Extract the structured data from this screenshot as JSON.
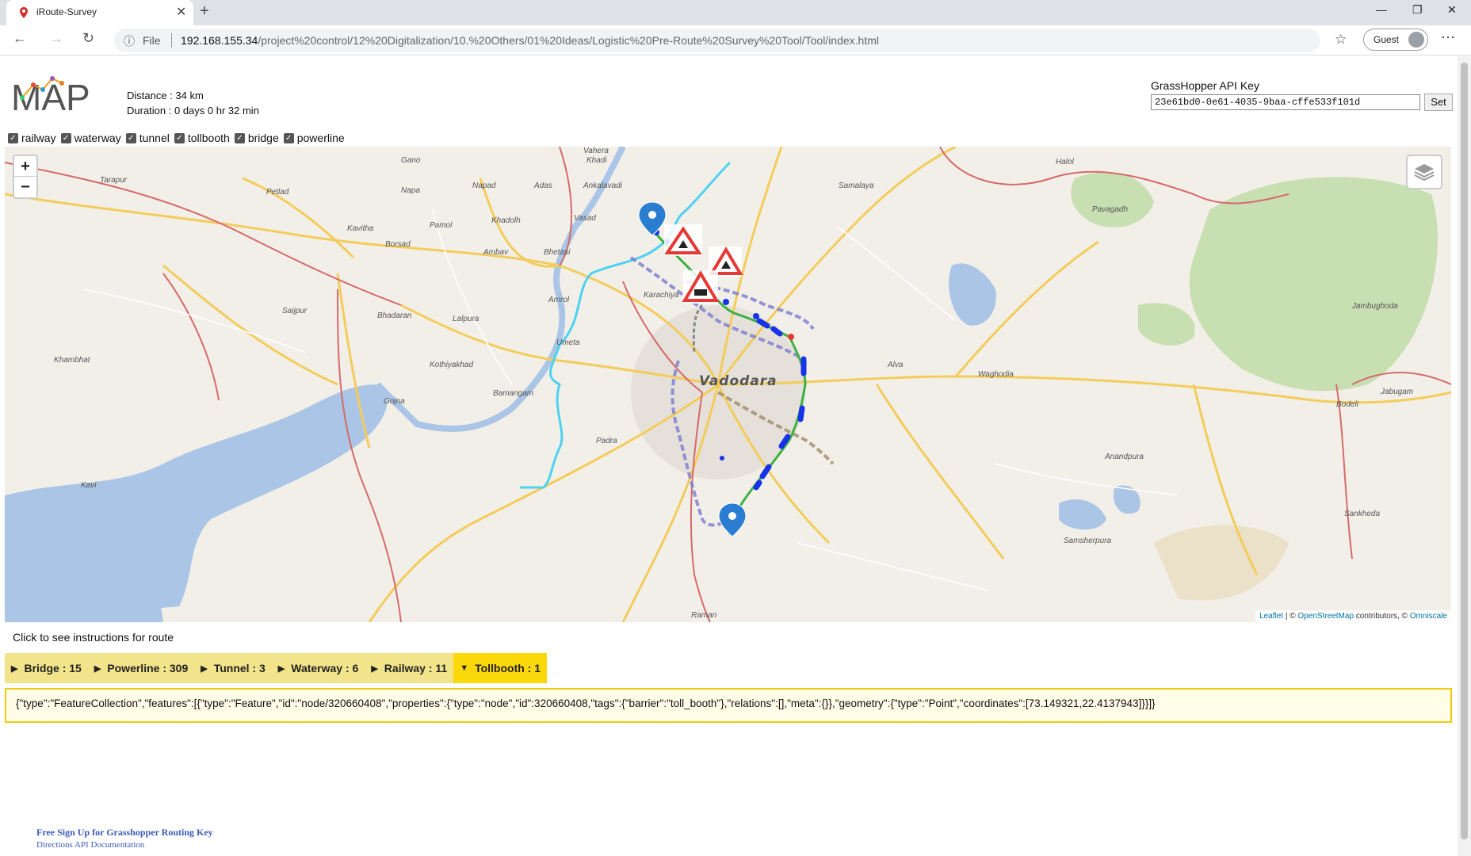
{
  "browser": {
    "tab_title": "iRoute-Survey",
    "close_glyph": "✕",
    "new_tab_glyph": "+",
    "omnibox": {
      "info_glyph": "ⓘ",
      "scheme_label": "File",
      "host": "192.168.155.34",
      "path": "/project%20control/12%20Digitalization/10.%20Others/01%20Ideas/Logistic%20Pre-Route%20Survey%20Tool/Tool/index.html"
    },
    "guest_label": "Guest",
    "star_icon": "star-icon",
    "menu_glyph": "⋯"
  },
  "header": {
    "logo_text": "MAP",
    "distance": "Distance : 34 km",
    "duration": "Duration : 0 days 0 hr 32 min",
    "api_label": "GrassHopper API Key",
    "api_key": "23e61bd0-0e61-4035-9baa-cffe533f101d",
    "set_label": "Set"
  },
  "layers": [
    {
      "label": "railway",
      "checked": true
    },
    {
      "label": "waterway",
      "checked": true
    },
    {
      "label": "tunnel",
      "checked": true
    },
    {
      "label": "tollbooth",
      "checked": true
    },
    {
      "label": "bridge",
      "checked": true
    },
    {
      "label": "powerline",
      "checked": true
    }
  ],
  "map": {
    "zoom_in": "+",
    "zoom_out": "−",
    "attribution": {
      "leaflet": "Leaflet",
      "sep": " | © ",
      "osm": "OpenStreetMap",
      "contributors": " contributors, © ",
      "omniscale": "Omniscale"
    },
    "labels": {
      "vadodara": "Vadodara",
      "tarapur": "Tarapur",
      "petlad": "Petlad",
      "gano": "Gano",
      "napa": "Napa",
      "napad": "Napad",
      "adas": "Adas",
      "ankalavadi": "Ankalavadi",
      "vahera": "Vahera",
      "khadi": "Khadi",
      "vasad": "Vasad",
      "khadolh": "Khadolh",
      "pamol": "Pamol",
      "kavitha": "Kavitha",
      "borsad": "Borsad",
      "ambav": "Ambav",
      "bhetasi": "Bhetasi",
      "saijpur": "Saijpur",
      "bhadaran": "Bhadaran",
      "lalpura": "Lalpura",
      "amrol": "Amrol",
      "karachiya": "Karachiya",
      "umeta": "Umeta",
      "khambhat": "Khambhat",
      "kothiyakhad": "Kothiyakhad",
      "bamangam": "Bamangam",
      "gojna": "Gojna",
      "padra": "Padra",
      "kavi": "Kavi",
      "raman": "Raman",
      "samalaya": "Samalaya",
      "halol": "Halol",
      "pavagadh": "Pavagadh",
      "jambughoda": "Jambughoda",
      "alva": "Alva",
      "waghodia": "Waghodia",
      "jabugam": "Jabugam",
      "bodeli": "Bodeli",
      "anandpura": "Anandpura",
      "sankheda": "Sankheda",
      "samsherpura": "Samsherpura"
    }
  },
  "instructions_text": "Click to see instructions for route",
  "feature_tabs": [
    {
      "label": "Bridge : 15",
      "active": false
    },
    {
      "label": "Powerline : 309",
      "active": false
    },
    {
      "label": "Tunnel : 3",
      "active": false
    },
    {
      "label": "Waterway : 6",
      "active": false
    },
    {
      "label": "Railway : 11",
      "active": false
    },
    {
      "label": "Tollbooth : 1",
      "active": true
    }
  ],
  "output_text": "{\"type\":\"FeatureCollection\",\"features\":[{\"type\":\"Feature\",\"id\":\"node/320660408\",\"properties\":{\"type\":\"node\",\"id\":320660408,\"tags\":{\"barrier\":\"toll_booth\"},\"relations\":[],\"meta\":{}},\"geometry\":{\"type\":\"Point\",\"coordinates\":[73.149321,22.4137943]}}]}",
  "footer": {
    "signup": "Free Sign Up for Grasshopper Routing Key",
    "docs": "Directions API Documentation"
  },
  "colors": {
    "tab_active": "#fbd80a",
    "tab_bar": "#f2e48a",
    "route_green": "#3cb043",
    "waterway": "#4dd2f0",
    "railway_dash": "#7b7bd0",
    "marker": "#2a7dd1",
    "link": "#3b5bb8"
  }
}
